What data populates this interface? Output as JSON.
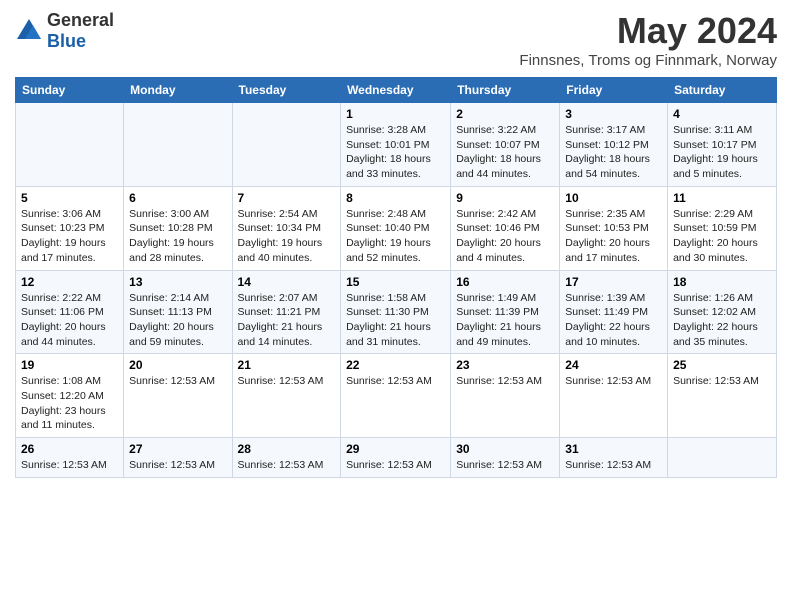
{
  "header": {
    "logo_general": "General",
    "logo_blue": "Blue",
    "month_title": "May 2024",
    "location": "Finnsnes, Troms og Finnmark, Norway"
  },
  "days_of_week": [
    "Sunday",
    "Monday",
    "Tuesday",
    "Wednesday",
    "Thursday",
    "Friday",
    "Saturday"
  ],
  "weeks": [
    [
      {
        "day": "",
        "info": ""
      },
      {
        "day": "",
        "info": ""
      },
      {
        "day": "",
        "info": ""
      },
      {
        "day": "1",
        "info": "Sunrise: 3:28 AM\nSunset: 10:01 PM\nDaylight: 18 hours and 33 minutes."
      },
      {
        "day": "2",
        "info": "Sunrise: 3:22 AM\nSunset: 10:07 PM\nDaylight: 18 hours and 44 minutes."
      },
      {
        "day": "3",
        "info": "Sunrise: 3:17 AM\nSunset: 10:12 PM\nDaylight: 18 hours and 54 minutes."
      },
      {
        "day": "4",
        "info": "Sunrise: 3:11 AM\nSunset: 10:17 PM\nDaylight: 19 hours and 5 minutes."
      }
    ],
    [
      {
        "day": "5",
        "info": "Sunrise: 3:06 AM\nSunset: 10:23 PM\nDaylight: 19 hours and 17 minutes."
      },
      {
        "day": "6",
        "info": "Sunrise: 3:00 AM\nSunset: 10:28 PM\nDaylight: 19 hours and 28 minutes."
      },
      {
        "day": "7",
        "info": "Sunrise: 2:54 AM\nSunset: 10:34 PM\nDaylight: 19 hours and 40 minutes."
      },
      {
        "day": "8",
        "info": "Sunrise: 2:48 AM\nSunset: 10:40 PM\nDaylight: 19 hours and 52 minutes."
      },
      {
        "day": "9",
        "info": "Sunrise: 2:42 AM\nSunset: 10:46 PM\nDaylight: 20 hours and 4 minutes."
      },
      {
        "day": "10",
        "info": "Sunrise: 2:35 AM\nSunset: 10:53 PM\nDaylight: 20 hours and 17 minutes."
      },
      {
        "day": "11",
        "info": "Sunrise: 2:29 AM\nSunset: 10:59 PM\nDaylight: 20 hours and 30 minutes."
      }
    ],
    [
      {
        "day": "12",
        "info": "Sunrise: 2:22 AM\nSunset: 11:06 PM\nDaylight: 20 hours and 44 minutes."
      },
      {
        "day": "13",
        "info": "Sunrise: 2:14 AM\nSunset: 11:13 PM\nDaylight: 20 hours and 59 minutes."
      },
      {
        "day": "14",
        "info": "Sunrise: 2:07 AM\nSunset: 11:21 PM\nDaylight: 21 hours and 14 minutes."
      },
      {
        "day": "15",
        "info": "Sunrise: 1:58 AM\nSunset: 11:30 PM\nDaylight: 21 hours and 31 minutes."
      },
      {
        "day": "16",
        "info": "Sunrise: 1:49 AM\nSunset: 11:39 PM\nDaylight: 21 hours and 49 minutes."
      },
      {
        "day": "17",
        "info": "Sunrise: 1:39 AM\nSunset: 11:49 PM\nDaylight: 22 hours and 10 minutes."
      },
      {
        "day": "18",
        "info": "Sunrise: 1:26 AM\nSunset: 12:02 AM\nDaylight: 22 hours and 35 minutes."
      }
    ],
    [
      {
        "day": "19",
        "info": "Sunrise: 1:08 AM\nSunset: 12:20 AM\nDaylight: 23 hours and 11 minutes."
      },
      {
        "day": "20",
        "info": "Sunrise: 12:53 AM"
      },
      {
        "day": "21",
        "info": "Sunrise: 12:53 AM"
      },
      {
        "day": "22",
        "info": "Sunrise: 12:53 AM"
      },
      {
        "day": "23",
        "info": "Sunrise: 12:53 AM"
      },
      {
        "day": "24",
        "info": "Sunrise: 12:53 AM"
      },
      {
        "day": "25",
        "info": "Sunrise: 12:53 AM"
      }
    ],
    [
      {
        "day": "26",
        "info": "Sunrise: 12:53 AM"
      },
      {
        "day": "27",
        "info": "Sunrise: 12:53 AM"
      },
      {
        "day": "28",
        "info": "Sunrise: 12:53 AM"
      },
      {
        "day": "29",
        "info": "Sunrise: 12:53 AM"
      },
      {
        "day": "30",
        "info": "Sunrise: 12:53 AM"
      },
      {
        "day": "31",
        "info": "Sunrise: 12:53 AM"
      },
      {
        "day": "",
        "info": ""
      }
    ]
  ]
}
